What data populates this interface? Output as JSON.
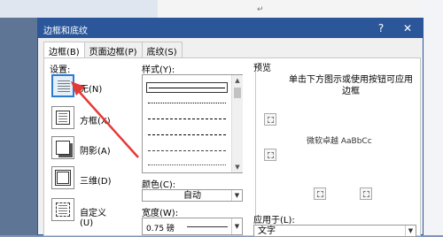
{
  "dialog": {
    "title": "边框和底纹",
    "help": "?",
    "close": "✕"
  },
  "tabs": [
    {
      "label": "边框(B)",
      "active": true
    },
    {
      "label": "页面边框(P)",
      "active": false
    },
    {
      "label": "底纹(S)",
      "active": false
    }
  ],
  "settings": {
    "label": "设置:",
    "items": [
      {
        "label": "无(N)",
        "icon": "no-border-icon",
        "selected": true
      },
      {
        "label": "方框(X)",
        "icon": "box-border-icon",
        "selected": false
      },
      {
        "label": "阴影(A)",
        "icon": "shadow-border-icon",
        "selected": false
      },
      {
        "label": "三维(D)",
        "icon": "3d-border-icon",
        "selected": false
      },
      {
        "label": "自定义(U)",
        "icon": "custom-border-icon",
        "selected": false
      }
    ]
  },
  "style": {
    "label": "样式(Y):"
  },
  "color": {
    "label": "颜色(C):",
    "value": "自动"
  },
  "width": {
    "label": "宽度(W):",
    "value": "0.75 磅"
  },
  "preview": {
    "label": "预览",
    "hint": "单击下方图示或使用按钮可应用边框",
    "sample_text": "微软卓越 AaBbCc"
  },
  "apply": {
    "label": "应用于(L):",
    "value": "文字"
  },
  "colors": {
    "accent": "#2b579a",
    "annotation_arrow": "#e53935"
  }
}
